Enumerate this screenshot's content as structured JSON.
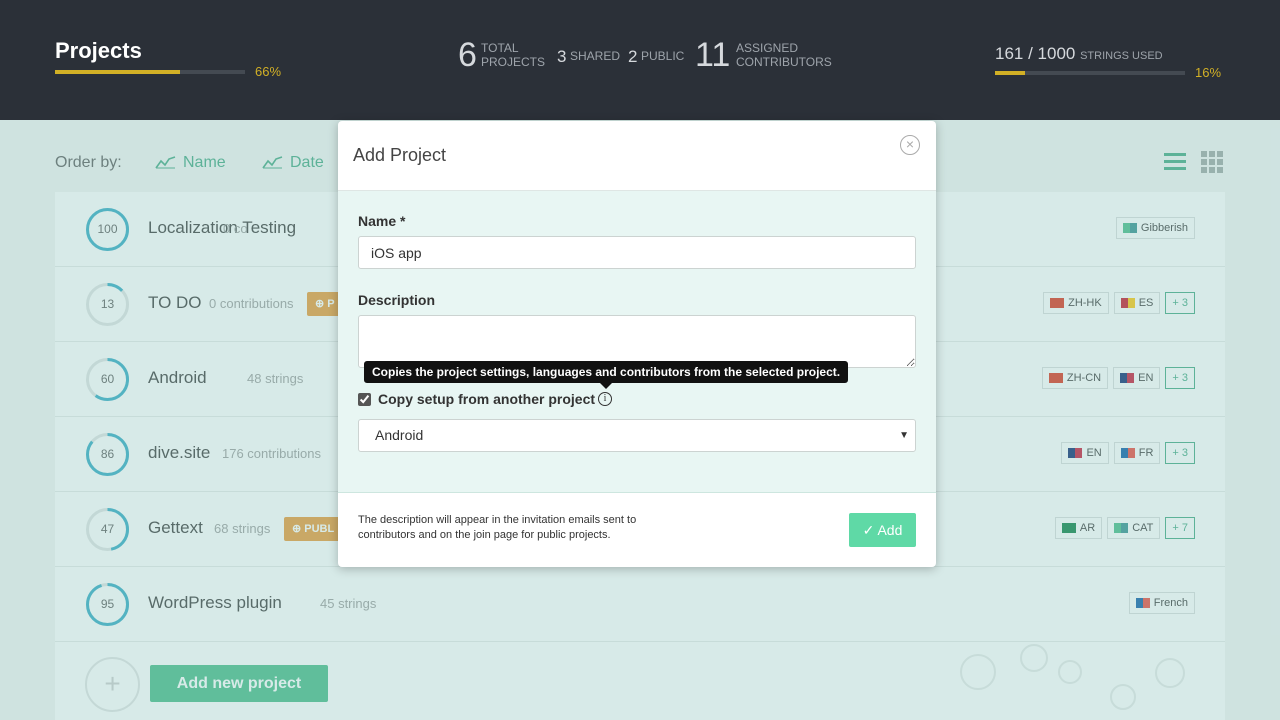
{
  "header": {
    "title": "Projects",
    "progress_pct": 66,
    "progress_label": "66%",
    "total_projects": {
      "value": "6",
      "label_1": "TOTAL",
      "label_2": "PROJECTS"
    },
    "shared": {
      "value": "3",
      "label": "SHARED"
    },
    "public": {
      "value": "2",
      "label": "PUBLIC"
    },
    "contributors": {
      "value": "11",
      "label_1": "ASSIGNED",
      "label_2": "CONTRIBUTORS"
    },
    "strings": {
      "used": "161 / 1000",
      "label": "STRINGS USED",
      "pct_value": 16,
      "pct_label": "16%"
    }
  },
  "order": {
    "label": "Order by:",
    "options": [
      "Name",
      "Date"
    ]
  },
  "projects": [
    {
      "pct": "100",
      "name": "Localization Testing",
      "meta": "0 co",
      "langs": [
        {
          "code": "Gibberish",
          "flag": "gibberish"
        }
      ],
      "more": ""
    },
    {
      "pct": "13",
      "name": "TO DO",
      "meta": "0 contributions",
      "badge": "P",
      "langs": [
        {
          "code": "ZH-HK",
          "flag": "hk"
        },
        {
          "code": "ES",
          "flag": "es"
        }
      ],
      "more": "+ 3"
    },
    {
      "pct": "60",
      "name": "Android",
      "meta": "48 strings",
      "langs": [
        {
          "code": "ZH-CN",
          "flag": "cn"
        },
        {
          "code": "EN",
          "flag": "gb"
        }
      ],
      "more": "+ 3"
    },
    {
      "pct": "86",
      "name": "dive.site",
      "meta": "176 contributions",
      "langs": [
        {
          "code": "EN",
          "flag": "gb"
        },
        {
          "code": "FR",
          "flag": "fr"
        }
      ],
      "more": "+ 3"
    },
    {
      "pct": "47",
      "name": "Gettext",
      "meta": "68 strings",
      "badge": "PUBL",
      "langs": [
        {
          "code": "AR",
          "flag": "ar"
        },
        {
          "code": "CAT",
          "flag": "gibberish"
        }
      ],
      "more": "+ 7"
    },
    {
      "pct": "95",
      "name": "WordPress plugin",
      "meta": "45 strings",
      "langs": [
        {
          "code": "French",
          "flag": "fr"
        }
      ],
      "more": ""
    }
  ],
  "add_new_project": {
    "label": "Add new project",
    "plus": "+"
  },
  "modal": {
    "title": "Add Project",
    "close": "×",
    "name_label": "Name *",
    "name_value": "iOS app",
    "description_label": "Description",
    "description_value": "",
    "tooltip": "Copies the project settings, languages and contributors from the selected project.",
    "copy_label": "Copy setup from another project",
    "copy_checked": true,
    "info_glyph": "i",
    "select_value": "Android",
    "footer_note": "The description will appear in the invitation emails sent to contributors and on the join page for public projects.",
    "add_label": "✓ Add"
  },
  "colors": {
    "accent": "#3fb983",
    "gold": "#d2b026",
    "header_bg": "#2b3038"
  }
}
